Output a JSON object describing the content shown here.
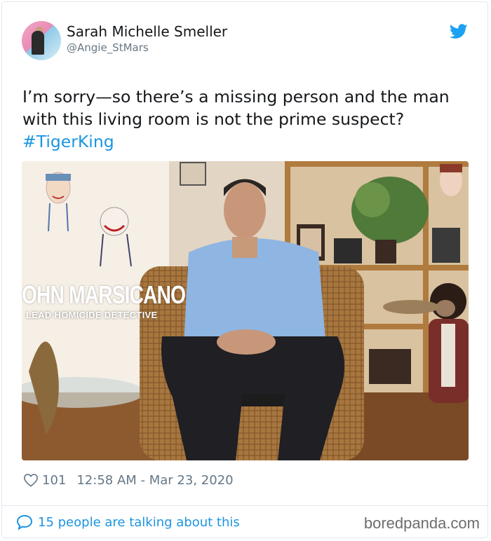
{
  "tweet": {
    "author_name": "Sarah Michelle Smeller",
    "author_handle": "@Angie_StMars",
    "text": "I’m sorry—so there’s a missing person and the man with this living room is not the prime suspect?",
    "hashtag": "#TigerKing",
    "likes": "101",
    "timestamp": "12:58 AM - Mar 23, 2020",
    "talking": "15 people are talking about this"
  },
  "media": {
    "overlay_name": "OHN MARSICANO",
    "overlay_title": "LEAD HOMICIDE DETECTIVE"
  },
  "credit": "boredpanda.com",
  "colors": {
    "link": "#1b95e0",
    "muted": "#657786",
    "text": "#14171a",
    "border": "#e1e8ed"
  },
  "icons": {
    "brand": "twitter-bird-icon",
    "like": "heart-icon",
    "reply": "speech-bubble-icon"
  }
}
